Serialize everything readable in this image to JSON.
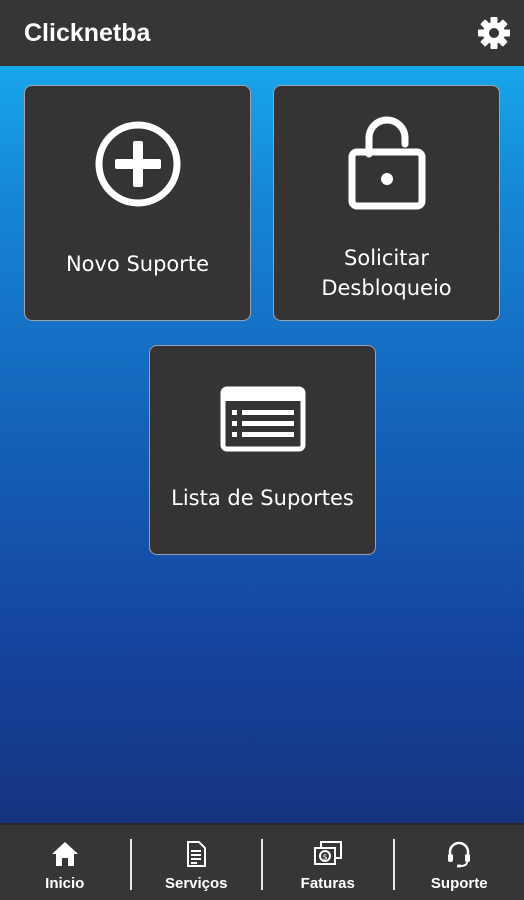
{
  "app": {
    "title": "Clicknetba"
  },
  "tiles": [
    {
      "label": "Novo Suporte",
      "icon": "plus-circle-icon"
    },
    {
      "label": "Solicitar Desbloqueio",
      "icon": "unlock-icon"
    },
    {
      "label": "Lista de Suportes",
      "icon": "list-icon"
    }
  ],
  "nav": [
    {
      "label": "Inicio",
      "icon": "home-icon"
    },
    {
      "label": "Serviços",
      "icon": "document-icon"
    },
    {
      "label": "Faturas",
      "icon": "money-icon"
    },
    {
      "label": "Suporte",
      "icon": "headset-icon"
    }
  ],
  "colors": {
    "appbar": "#373536",
    "tile": "#353334",
    "gradient_top": "#17a6ea",
    "gradient_bottom": "#15337f"
  }
}
